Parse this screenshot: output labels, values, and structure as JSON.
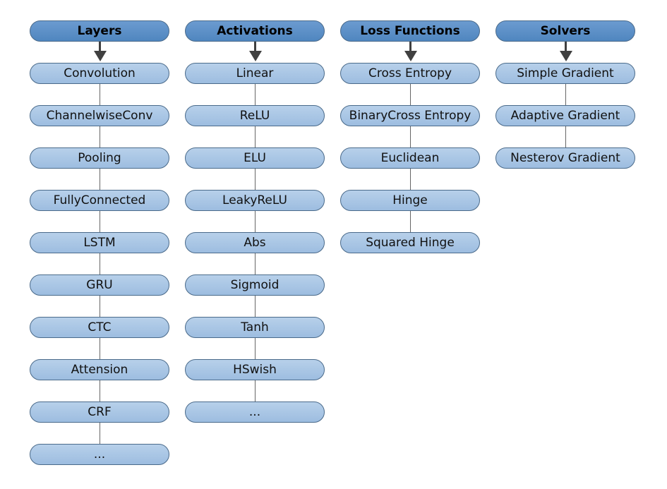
{
  "columns": [
    {
      "title": "Layers",
      "items": [
        "Convolution",
        "ChannelwiseConv",
        "Pooling",
        "FullyConnected",
        "LSTM",
        "GRU",
        "CTC",
        "Attension",
        "CRF",
        "..."
      ]
    },
    {
      "title": "Activations",
      "items": [
        "Linear",
        "ReLU",
        "ELU",
        "LeakyReLU",
        "Abs",
        "Sigmoid",
        "Tanh",
        "HSwish",
        "..."
      ]
    },
    {
      "title": "Loss Functions",
      "items": [
        "Cross Entropy",
        "BinaryCross Entropy",
        "Euclidean",
        "Hinge",
        "Squared Hinge"
      ]
    },
    {
      "title": "Solvers",
      "items": [
        "Simple Gradient",
        "Adaptive Gradient",
        "Nesterov Gradient"
      ]
    }
  ],
  "colors": {
    "header": "#5b8fc6",
    "item": "#a9c6e4",
    "arrow": "#404040"
  }
}
